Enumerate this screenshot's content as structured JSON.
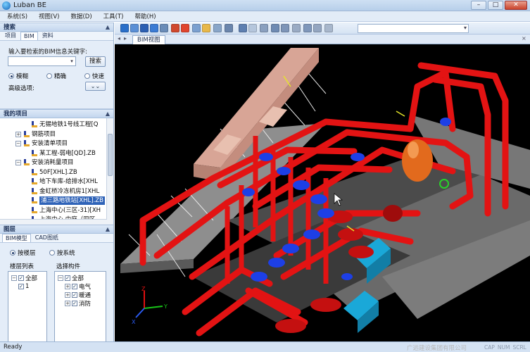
{
  "window": {
    "title": "Luban BE"
  },
  "menu": [
    "系统(S)",
    "视图(V)",
    "数据(D)",
    "工具(T)",
    "帮助(H)"
  ],
  "search_pane": {
    "header": "搜索",
    "tabs": [
      "项目",
      "BIM",
      "资料"
    ],
    "hint": "输入要检索的BIM信息关键字:",
    "input_value": "",
    "search_button": "搜索",
    "options": [
      "模糊",
      "精确",
      "快速"
    ],
    "advanced_label": "高级选项:"
  },
  "project_pane": {
    "header": "我的项目",
    "items": [
      {
        "label": "无锡地铁1号线工程[Q",
        "icon": "doc",
        "level": 2,
        "expander": ""
      },
      {
        "label": "钢筋项目",
        "icon": "doc",
        "level": 1,
        "expander": "+"
      },
      {
        "label": "安装清单项目",
        "icon": "doc",
        "level": 1,
        "expander": "−"
      },
      {
        "label": "某工程-弱电[QD].ZB",
        "icon": "doc",
        "level": 2,
        "expander": ""
      },
      {
        "label": "安装消耗量项目",
        "icon": "doc",
        "level": 1,
        "expander": "−"
      },
      {
        "label": "50F[XHL].ZB",
        "icon": "doc",
        "level": 2,
        "expander": ""
      },
      {
        "label": "地下车库-给排水[XHL",
        "icon": "doc",
        "level": 2,
        "expander": ""
      },
      {
        "label": "金虹桥冷冻机房1[XHL",
        "icon": "doc",
        "level": 2,
        "expander": ""
      },
      {
        "label": "浦三路地铁站[XHL].ZB",
        "icon": "doc",
        "level": 2,
        "expander": "",
        "selected": true
      },
      {
        "label": "上海中心(三区-31)[XH",
        "icon": "doc",
        "level": 2,
        "expander": ""
      },
      {
        "label": "上海中心 中庭（四区",
        "icon": "doc",
        "level": 2,
        "expander": ""
      }
    ]
  },
  "layer_pane": {
    "header": "图层",
    "tabs": [
      "BIM模型",
      "CAD图纸"
    ],
    "modes": [
      "按楼层",
      "按系统"
    ],
    "floor_list_label": "楼层列表",
    "component_label": "选择构件",
    "floors": [
      {
        "label": "全部",
        "level": 0,
        "expander": "−"
      },
      {
        "label": "1",
        "level": 1,
        "expander": ""
      }
    ],
    "components": [
      {
        "label": "全部",
        "level": 0,
        "expander": "−"
      },
      {
        "label": "电气",
        "level": 1,
        "expander": "+"
      },
      {
        "label": "暖通",
        "level": 1,
        "expander": "+"
      },
      {
        "label": "消防",
        "level": 1,
        "expander": "+"
      }
    ]
  },
  "viewer": {
    "tab": "BIM视图",
    "axis": {
      "x": "X",
      "y": "Y",
      "z": "Z"
    }
  },
  "status": {
    "text": "Ready",
    "company": "广远建设集团有限公司",
    "keys": [
      "CAP",
      "NUM",
      "SCRL"
    ]
  },
  "colors": {
    "pipe": "#e11212",
    "valve": "#1c3fe0",
    "duct": "#d9a89a",
    "tank": "#e06a1e",
    "cyan_box": "#19a7d6",
    "floor": "#9a9a9a"
  }
}
